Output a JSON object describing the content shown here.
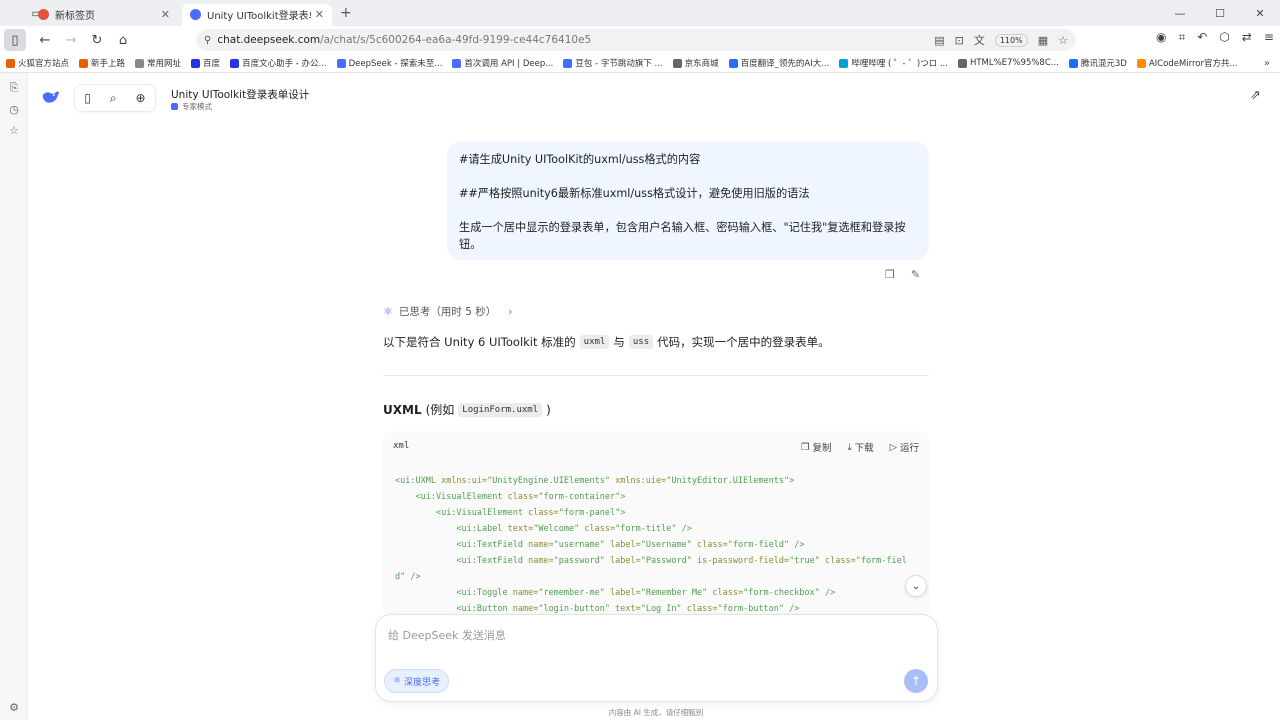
{
  "browser": {
    "tabs": [
      {
        "title": "新标签页",
        "color": "#e5533d"
      },
      {
        "title": "Unity UIToolkit登录表单设计 ·",
        "color": "#4d6bfe"
      }
    ],
    "url_host": "chat.deepseek.com",
    "url_path": "/a/chat/s/5c600264-ea6a-49fd-9199-ce44c76410e5",
    "zoom": "110%",
    "bookmarks": [
      {
        "label": "火狐官方站点",
        "color": "#e66000"
      },
      {
        "label": "新手上路",
        "color": "#e66000"
      },
      {
        "label": "常用网址",
        "color": "#888888"
      },
      {
        "label": "百度",
        "color": "#2932e1"
      },
      {
        "label": "百度文心助手 - 办公...",
        "color": "#2932e1"
      },
      {
        "label": "DeepSeek - 探索未至...",
        "color": "#4d6bfe"
      },
      {
        "label": "首次调用 API | Deep...",
        "color": "#4d6bfe"
      },
      {
        "label": "豆包 - 字节跳动旗下 ...",
        "color": "#3c6ff5"
      },
      {
        "label": "京东商城",
        "color": "#666666"
      },
      {
        "label": "百度翻译_领先的AI大...",
        "color": "#2a6cf2"
      },
      {
        "label": "哔哩哔哩 ( ゜- ゜)つロ ...",
        "color": "#00a1d6"
      },
      {
        "label": "HTML%E7%95%8C...",
        "color": "#666666"
      },
      {
        "label": "腾讯混元3D",
        "color": "#1f6bff"
      },
      {
        "label": "AICodeMirror官方共...",
        "color": "#ff8c00"
      }
    ]
  },
  "app": {
    "conversation_title": "Unity UIToolkit登录表单设计",
    "mode_label": "专家模式"
  },
  "user_message": {
    "p1": "#请生成Unity UIToolKit的uxml/uss格式的内容",
    "p2": "##严格按照unity6最新标准uxml/uss格式设计，避免使用旧版的语法",
    "p3": "生成一个居中显示的登录表单，包含用户名输入框、密码输入框、\"记住我\"复选框和登录按钮。"
  },
  "assistant": {
    "thought_label": "已思考（用时 5 秒）",
    "intro_a": "以下是符合 Unity 6 UIToolkit 标准的",
    "intro_code1": "uxml",
    "intro_b": "与",
    "intro_code2": "uss",
    "intro_c": "代码，实现一个居中的登录表单。",
    "section_title": "UXML",
    "section_paren_open": "(例如",
    "section_file": "LoginForm.uxml",
    "section_paren_close": ")",
    "code": {
      "lang": "xml",
      "copy": "复制",
      "download": "下载",
      "run": "运行",
      "l1_tag": "<ui:UXML",
      "l1_a1": "xmlns:ui=",
      "l1_v1": "\"UnityEngine.UIElements\"",
      "l1_a2": "xmlns:uie=",
      "l1_v2": "\"UnityEditor.UIElements\"",
      "l1_end": ">",
      "l2_tag": "<ui:VisualElement",
      "l2_a1": "class=",
      "l2_v1": "\"form-container\"",
      "l2_end": ">",
      "l3_tag": "<ui:VisualElement",
      "l3_a1": "class=",
      "l3_v1": "\"form-panel\"",
      "l3_end": ">",
      "l4_tag": "<ui:Label",
      "l4_a1": "text=",
      "l4_v1": "\"Welcome\"",
      "l4_a2": "class=",
      "l4_v2": "\"form-title\"",
      "l4_end": "/>",
      "l5_tag": "<ui:TextField",
      "l5_a1": "name=",
      "l5_v1": "\"username\"",
      "l5_a2": "label=",
      "l5_v2": "\"Username\"",
      "l5_a3": "class=",
      "l5_v3": "\"form-field\"",
      "l5_end": "/>",
      "l6_tag": "<ui:TextField",
      "l6_a1": "name=",
      "l6_v1": "\"password\"",
      "l6_a2": "label=",
      "l6_v2": "\"Password\"",
      "l6_a3": "is-password-field=",
      "l6_v3": "\"true\"",
      "l6_a4": "class=",
      "l6_v4": "\"form-fiel",
      "l6b_v": "d\"",
      "l6b_end": "/>",
      "l7_tag": "<ui:Toggle",
      "l7_a1": "name=",
      "l7_v1": "\"remember-me\"",
      "l7_a2": "label=",
      "l7_v2": "\"Remember Me\"",
      "l7_a3": "class=",
      "l7_v3": "\"form-checkbox\"",
      "l7_end": "/>",
      "l8_tag": "<ui:Button",
      "l8_a1": "name=",
      "l8_v1": "\"login-button\"",
      "l8_a2": "text=",
      "l8_v2": "\"Log In\"",
      "l8_a3": "class=",
      "l8_v3": "\"form-button\"",
      "l8_end": "/>"
    }
  },
  "composer": {
    "placeholder": "给 DeepSeek 发送消息",
    "deep_think": "深度思考"
  },
  "footer": {
    "disclaimer": "内容由 AI 生成，请仔细甄别"
  },
  "colors": {
    "accent": "#4d6bfe",
    "user_bubble": "#eff6ff",
    "code_tag": "#50a14f",
    "code_attr": "#8a8f2f"
  }
}
